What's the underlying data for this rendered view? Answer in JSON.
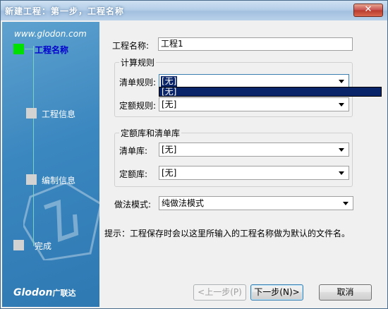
{
  "window": {
    "title": "新建工程：第一步，工程名称",
    "close_glyph": "✕"
  },
  "sidebar": {
    "site": "www.glodon.com",
    "steps": [
      {
        "label": "工程名称",
        "active": true
      },
      {
        "label": "工程信息",
        "active": false
      },
      {
        "label": "编制信息",
        "active": false
      },
      {
        "label": "完成",
        "active": false
      }
    ],
    "logo": "Glodon",
    "logo_cn": "广联达"
  },
  "form": {
    "project_name_label": "工程名称:",
    "project_name_value": "工程1",
    "calc_group_title": "计算规则",
    "bill_rule_label": "清单规则:",
    "bill_rule_value": "[无]",
    "quota_rule_label": "定额规则:",
    "quota_rule_value": "[无]",
    "lib_group_title": "定额库和清单库",
    "bill_lib_label": "清单库:",
    "bill_lib_value": "[无]",
    "quota_lib_label": "定额库:",
    "quota_lib_value": "[无]",
    "method_label": "做法模式:",
    "method_value": "纯做法模式",
    "dropdown_option": "[无]"
  },
  "hint": "提示：工程保存时会以这里所输入的工程名称做为默认的文件名。",
  "buttons": {
    "prev": "<上一步(P)",
    "next": "下一步(N)>",
    "cancel": "取消"
  }
}
